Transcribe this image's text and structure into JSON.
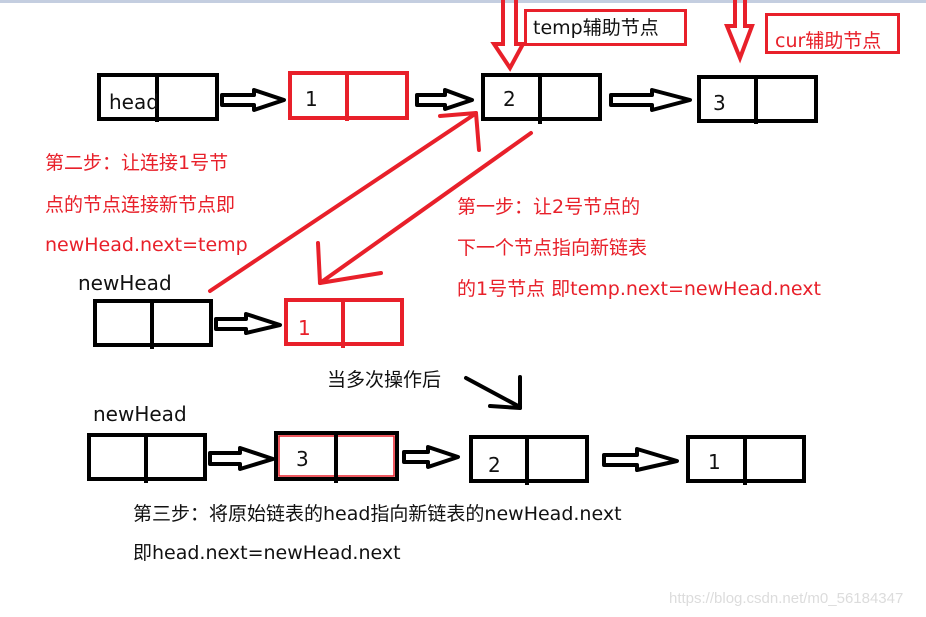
{
  "labels": {
    "temp_helper": "temp辅助节点",
    "cur_helper": "cur辅助节点",
    "head": "head",
    "new_head_1": "newHead",
    "new_head_2": "newHead",
    "after_many": "当多次操作后"
  },
  "steps": {
    "step2": [
      "第二步：让连接1号节",
      "点的节点连接新节点即",
      "newHead.next=temp"
    ],
    "step1": [
      "第一步：让2号节点的",
      "下一个节点指向新链表",
      "的1号节点 即temp.next=newHead.next"
    ],
    "step3": [
      "第三步：将原始链表的head指向新链表的newHead.next",
      "即head.next=newHead.next"
    ]
  },
  "original_list": {
    "nodes": [
      {
        "value": "",
        "color": "#000000"
      },
      {
        "value": "1",
        "color": "#e8202a"
      },
      {
        "value": "2",
        "color": "#000000"
      },
      {
        "value": "3",
        "color": "#000000"
      }
    ]
  },
  "partial_new_list": {
    "nodes": [
      {
        "value": "",
        "color": "#000000"
      },
      {
        "value": "1",
        "color": "#e8202a"
      }
    ]
  },
  "final_list": {
    "nodes": [
      {
        "value": "",
        "color": "#000000"
      },
      {
        "value": "3",
        "color": "#000000"
      },
      {
        "value": "2",
        "color": "#000000"
      },
      {
        "value": "1",
        "color": "#000000"
      }
    ]
  },
  "colors": {
    "accent_red": "#e8202a",
    "ink": "#000000"
  },
  "watermark": "https://blog.csdn.net/m0_56184347"
}
